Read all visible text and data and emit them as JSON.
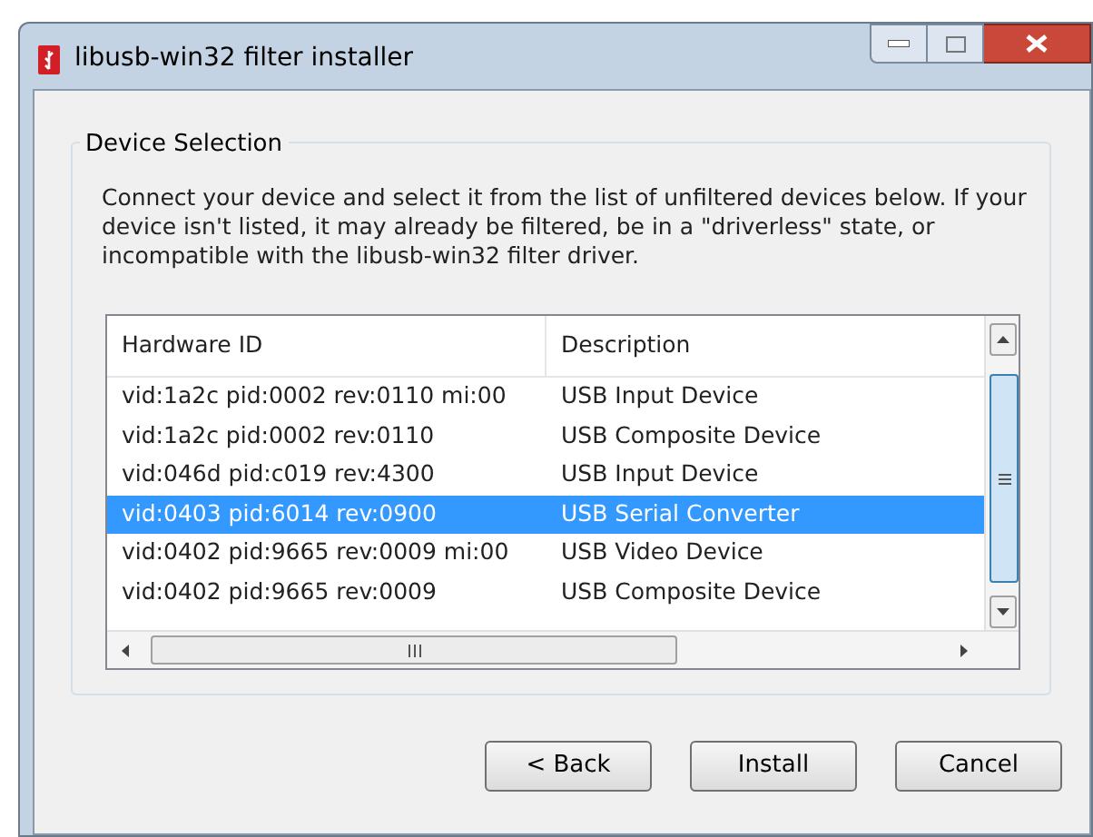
{
  "window": {
    "title": "libusb-win32 filter installer"
  },
  "group": {
    "title": "Device Selection",
    "description": "Connect your device and select it from the list of unfiltered devices below. If your device isn't listed, it may already be filtered, be in a \"driverless\" state, or incompatible with the libusb-win32 filter driver."
  },
  "table": {
    "columns": [
      "Hardware ID",
      "Description"
    ],
    "rows": [
      {
        "hardware_id": "vid:1a2c pid:0002 rev:0110 mi:00",
        "description": "USB Input Device",
        "selected": false
      },
      {
        "hardware_id": "vid:1a2c pid:0002 rev:0110",
        "description": "USB Composite Device",
        "selected": false
      },
      {
        "hardware_id": "vid:046d pid:c019 rev:4300",
        "description": "USB Input Device",
        "selected": false
      },
      {
        "hardware_id": "vid:0403 pid:6014 rev:0900",
        "description": "USB Serial Converter",
        "selected": true
      },
      {
        "hardware_id": "vid:0402 pid:9665 rev:0009 mi:00",
        "description": "USB Video Device",
        "selected": false
      },
      {
        "hardware_id": "vid:0402 pid:9665 rev:0009",
        "description": "USB Composite Device",
        "selected": false
      }
    ]
  },
  "buttons": [
    "< Back",
    "Install",
    "Cancel"
  ]
}
